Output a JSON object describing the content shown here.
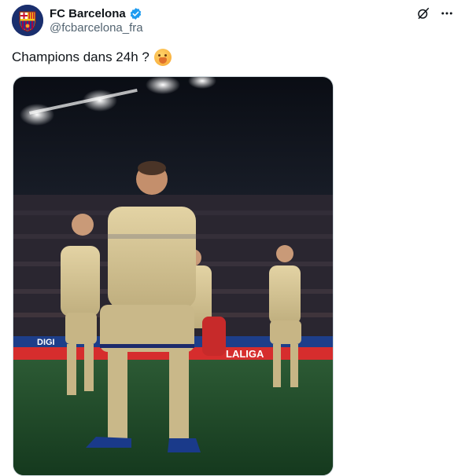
{
  "author": {
    "display_name": "FC Barcelona",
    "handle": "@fcbarcelona_fra",
    "verified": true,
    "avatar_icon": "fc-barcelona-crest"
  },
  "actions": {
    "grok_icon": "grok-icon",
    "more_icon": "more-options-icon"
  },
  "tweet": {
    "text": "Champions dans 24h ?",
    "emoji": "smiling-face-emoji"
  },
  "media": {
    "description_icon": "photo",
    "ad_boards": {
      "left": "DIGI",
      "center": "LALIGA"
    },
    "colors": {
      "kit": "#d9c796",
      "kit_trim": "#1c2a6b",
      "pitch": "#1f4f2a",
      "ad_red": "#d62d2d"
    }
  },
  "colors": {
    "text_primary": "#0f1419",
    "text_secondary": "#536471",
    "verified": "#1d9bf0",
    "border": "#cfd9de"
  }
}
